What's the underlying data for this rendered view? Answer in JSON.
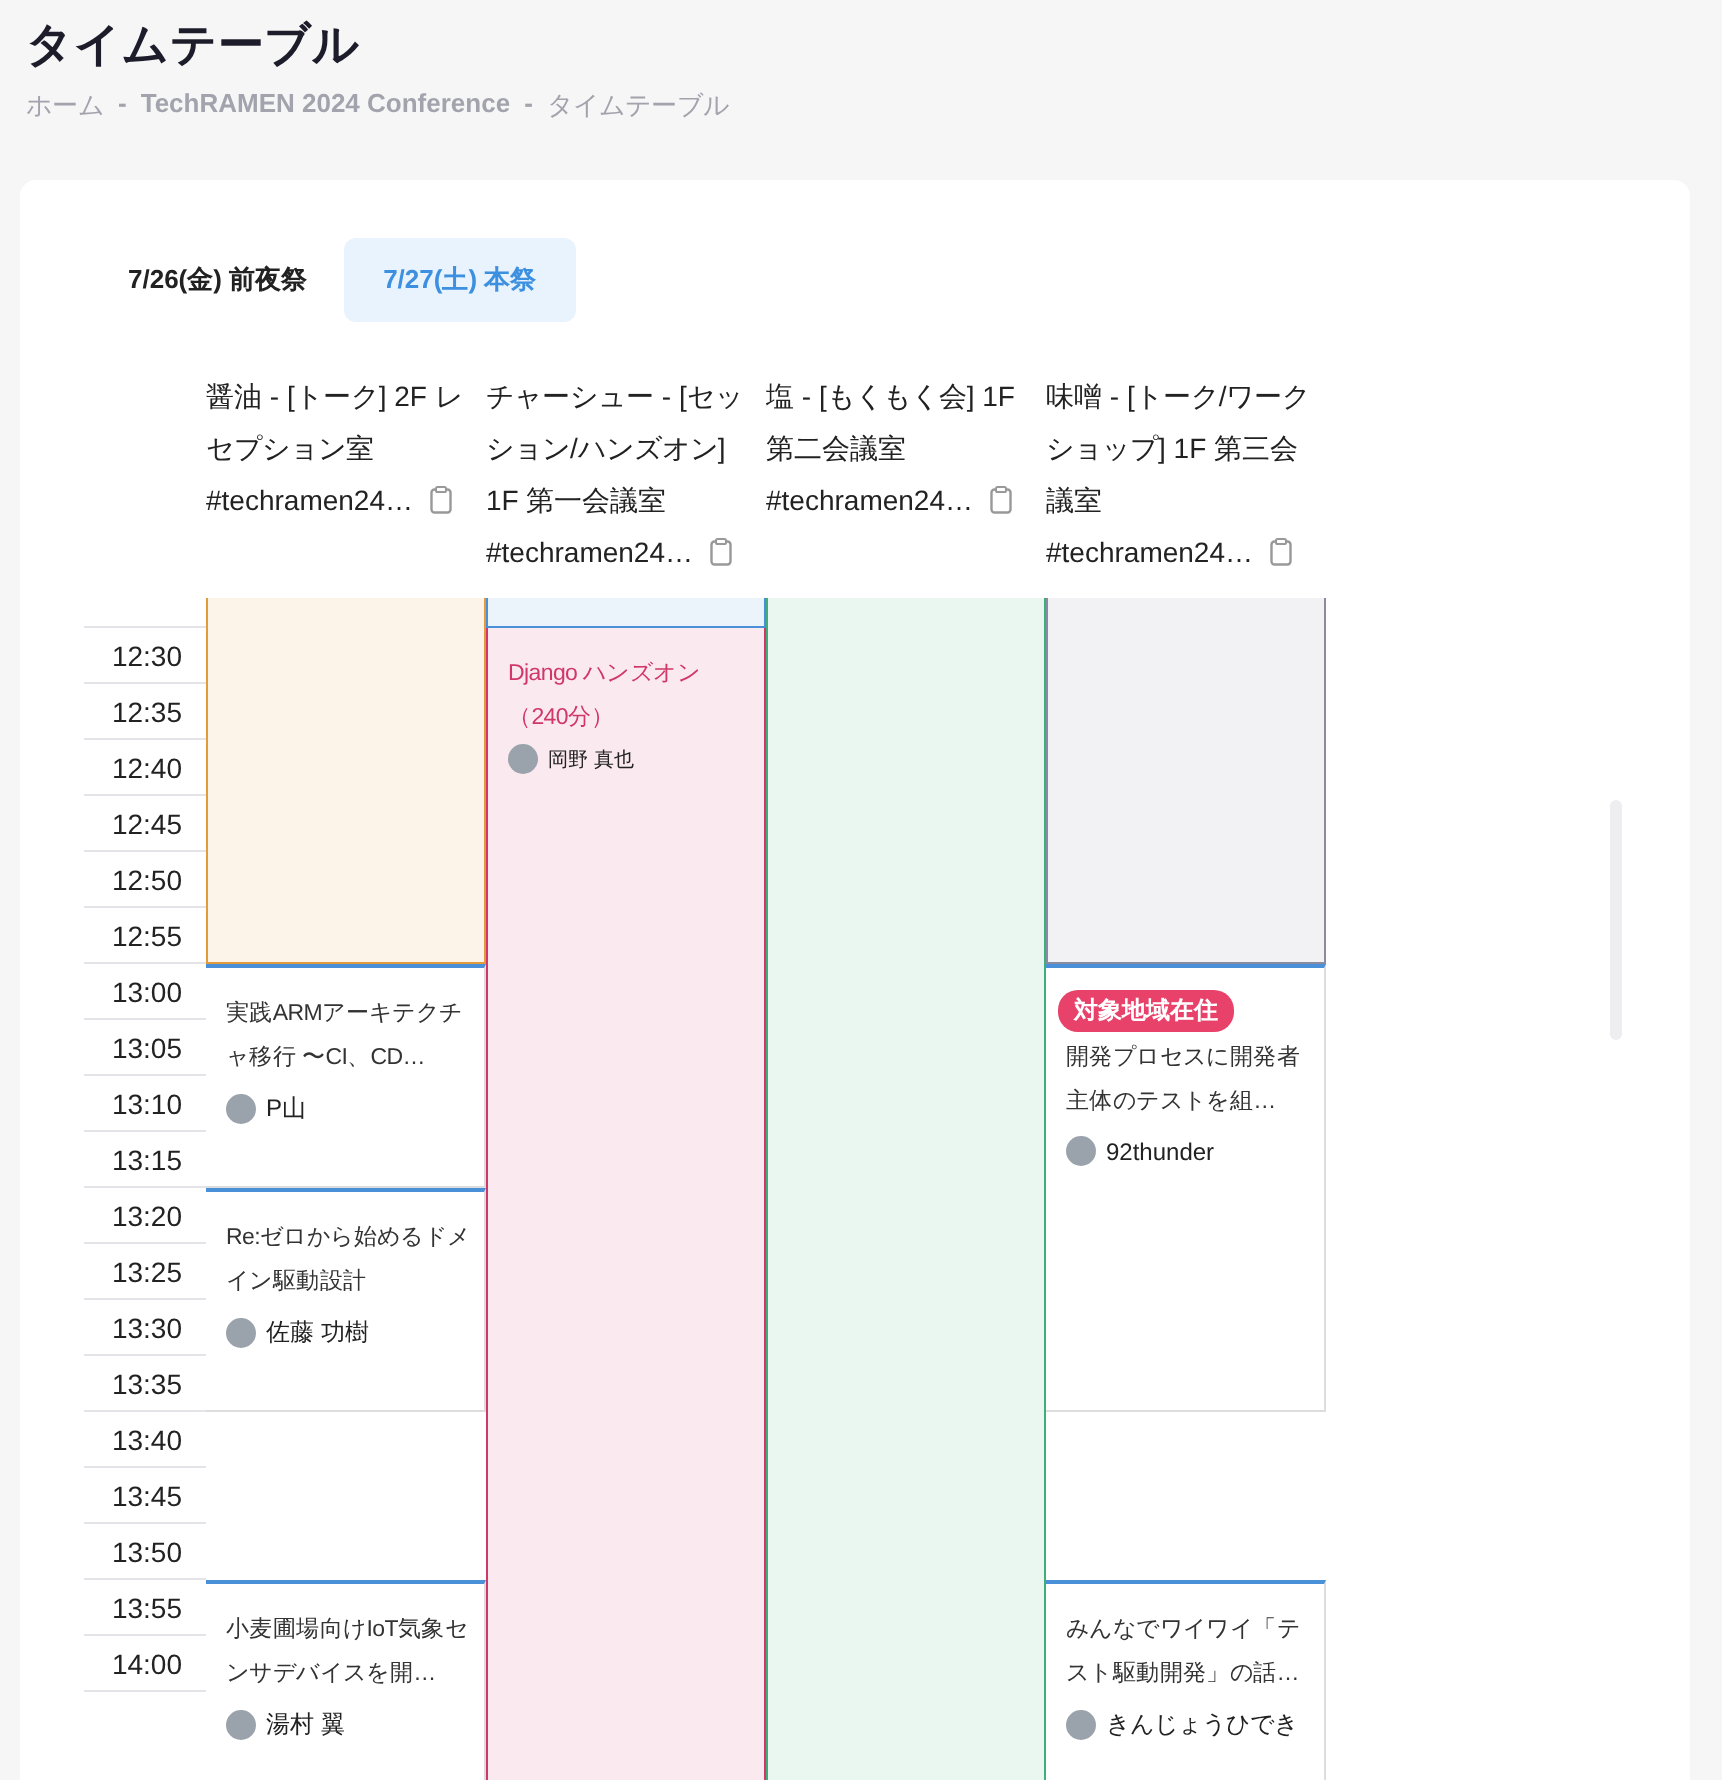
{
  "page": {
    "title": "タイムテーブル",
    "breadcrumb": [
      "ホーム",
      "-",
      "TechRAMEN 2024 Conference",
      "-",
      "タイムテーブル"
    ]
  },
  "tabs": [
    {
      "label": "7/26(金) 前夜祭",
      "selected": false
    },
    {
      "label": "7/27(土) 本祭",
      "selected": true
    }
  ],
  "tracks": [
    {
      "name": "醤油 - [トーク] 2F レセプション室",
      "hashtag": "#techramen24…",
      "sessions": [
        {
          "kind": "block",
          "color": "#e39a3b"
        },
        {
          "kind": "card",
          "color": "#4a90d9",
          "title": "実践ARMアーキテクチャ移行 〜CI、CD…",
          "speaker": "P山"
        },
        {
          "kind": "card",
          "color": "#4a90d9",
          "title": "Re:ゼロから始めるドメイン駆動設計",
          "speaker": "佐藤 功樹"
        },
        {
          "kind": "card",
          "color": "#4a90d9",
          "title": "小麦圃場向けIoT気象センサデバイスを開…",
          "speaker": "湯村 翼"
        }
      ]
    },
    {
      "name": "チャーシュー - [セッション/ハンズオン] 1F 第一会議室",
      "hashtag": "#techramen24…",
      "sessions": [
        {
          "kind": "block",
          "color": "#4a90d9"
        },
        {
          "kind": "block",
          "color": "#d0386a",
          "title": "Django ハンズオン（240分）",
          "speaker": "岡野 真也"
        }
      ]
    },
    {
      "name": "塩 - [もくもく会] 1F 第二会議室",
      "hashtag": "#techramen24…",
      "sessions": [
        {
          "kind": "block",
          "color": "#3fae79"
        }
      ]
    },
    {
      "name": "味噌 - [トーク/ワークショップ] 1F 第三会議室",
      "hashtag": "#techramen24…",
      "sessions": [
        {
          "kind": "block",
          "color": "#8a8aa0"
        },
        {
          "kind": "card",
          "color": "#4a90d9",
          "tag": "対象地域在住",
          "title": "開発プロセスに開発者主体のテストを組…",
          "speaker": "92thunder"
        },
        {
          "kind": "card",
          "color": "#4a90d9",
          "title": "みんなでワイワイ「テスト駆動開発」の話…",
          "speaker": "きんじょうひでき"
        }
      ]
    }
  ],
  "times": [
    "12:30",
    "12:35",
    "12:40",
    "12:45",
    "12:50",
    "12:55",
    "13:00",
    "13:05",
    "13:10",
    "13:15",
    "13:20",
    "13:25",
    "13:30",
    "13:35",
    "13:40",
    "13:45",
    "13:50",
    "13:55",
    "14:00"
  ]
}
